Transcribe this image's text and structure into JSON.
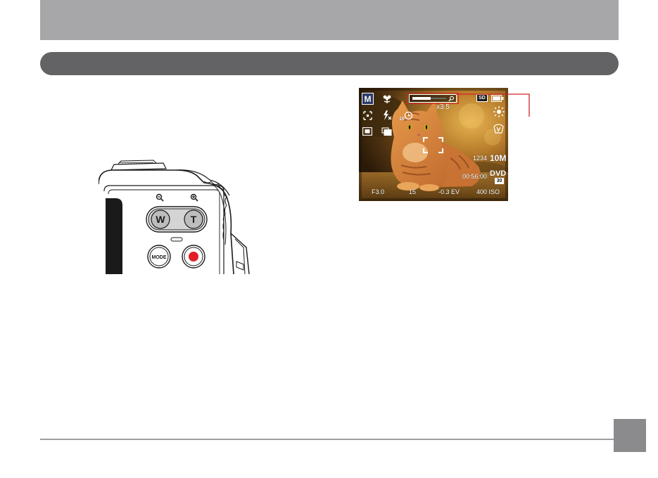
{
  "illustration": {
    "button_w": "W",
    "button_t": "T",
    "button_mode": "MODE"
  },
  "lcd": {
    "mode_badge": "M",
    "zoom_readout": "x3.5",
    "zoom_level_fraction": 0.55,
    "storage_badge": "SD",
    "selftimer_value": "10",
    "shots_remaining": "1234",
    "image_size": "10M",
    "record_time": "00:56:00",
    "video_format": "DVD",
    "video_fps": "30",
    "aperture": "F3.0",
    "shutter": "15",
    "exposure": "-0.3 EV",
    "iso": "400 ISO"
  },
  "colors": {
    "top_bar": "#a7a7a9",
    "section_bar": "#636365",
    "callout_line": "#d2232a",
    "record_button": "#e11f26",
    "page_box": "#8b8b8d"
  }
}
